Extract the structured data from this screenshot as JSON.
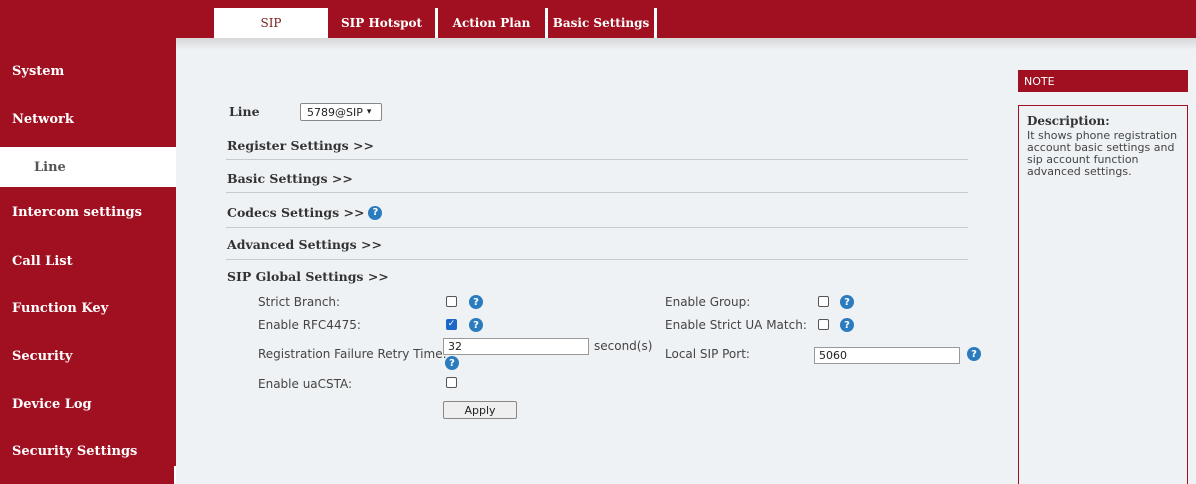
{
  "tabs": [
    {
      "label": "SIP",
      "active": true
    },
    {
      "label": "SIP Hotspot",
      "active": false
    },
    {
      "label": "Action Plan",
      "active": false
    },
    {
      "label": "Basic Settings",
      "active": false
    }
  ],
  "sidebar": {
    "items": [
      {
        "label": "System",
        "active": false
      },
      {
        "label": "Network",
        "active": false
      },
      {
        "label": "Line",
        "active": true
      },
      {
        "label": "Intercom settings",
        "active": false
      },
      {
        "label": "Call List",
        "active": false
      },
      {
        "label": "Function Key",
        "active": false
      },
      {
        "label": "Security",
        "active": false
      },
      {
        "label": "Device Log",
        "active": false
      },
      {
        "label": "Security Settings",
        "active": false
      }
    ]
  },
  "line": {
    "label": "Line",
    "selected": "5789@SIP"
  },
  "sections": {
    "register": "Register Settings >>",
    "basic": "Basic Settings >>",
    "codecs": "Codecs Settings >>",
    "advanced": "Advanced Settings >>",
    "sip_global": "SIP Global Settings >>"
  },
  "fields": {
    "strict_branch": {
      "label": "Strict Branch:",
      "checked": false
    },
    "enable_rfc4475": {
      "label": "Enable RFC4475:",
      "checked": true
    },
    "retry_time": {
      "label": "Registration Failure Retry Time:",
      "value": "32",
      "unit": "second(s)"
    },
    "enable_uacsta": {
      "label": "Enable uaCSTA:",
      "checked": false
    },
    "enable_group": {
      "label": "Enable Group:",
      "checked": false
    },
    "strict_ua_match": {
      "label": "Enable Strict UA Match:",
      "checked": false
    },
    "local_sip_port": {
      "label": "Local SIP Port:",
      "value": "5060"
    }
  },
  "apply_label": "Apply",
  "note": {
    "header": "NOTE",
    "title": "Description:",
    "text": "It shows phone registration account basic settings and sip account function advanced settings."
  },
  "icons": {
    "help": "?",
    "check": "✓",
    "dropdown": "⌄"
  },
  "colors": {
    "brand": "#a01020",
    "background": "#eff2f5",
    "help_icon": "#2b7bbf",
    "checkbox_checked": "#1a66c9"
  }
}
